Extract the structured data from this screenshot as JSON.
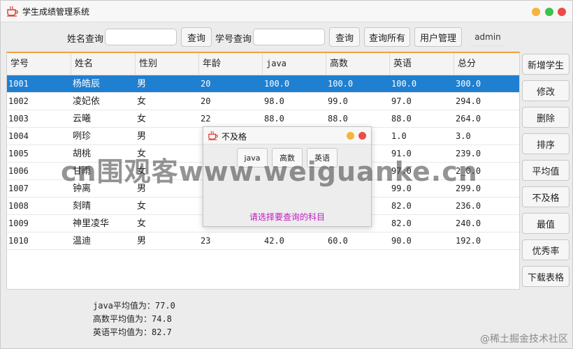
{
  "window": {
    "title": "学生成绩管理系统"
  },
  "search": {
    "name_label": "姓名查询",
    "name_value": "",
    "name_button": "查询",
    "id_label": "学号查询",
    "id_value": "",
    "id_button": "查询",
    "all_button": "查询所有",
    "user_button": "用户管理",
    "current_user": "admin"
  },
  "table": {
    "headers": [
      "学号",
      "姓名",
      "性别",
      "年龄",
      "java",
      "高数",
      "英语",
      "总分"
    ],
    "rows": [
      [
        "1001",
        "杨皓辰",
        "男",
        "20",
        "100.0",
        "100.0",
        "100.0",
        "300.0"
      ],
      [
        "1002",
        "凌妃依",
        "女",
        "20",
        "98.0",
        "99.0",
        "97.0",
        "294.0"
      ],
      [
        "1003",
        "云曦",
        "女",
        "22",
        "88.0",
        "88.0",
        "88.0",
        "264.0"
      ],
      [
        "1004",
        "咧珍",
        "男",
        "",
        "",
        "",
        "1.0",
        "3.0"
      ],
      [
        "1005",
        "胡桃",
        "女",
        "",
        "",
        "",
        "91.0",
        "239.0"
      ],
      [
        "1006",
        "甘雨",
        "女",
        "",
        "",
        "",
        "97.0",
        "2_0.0"
      ],
      [
        "1007",
        "钟离",
        "男",
        "",
        "",
        "",
        "99.0",
        "299.0"
      ],
      [
        "1008",
        "刻晴",
        "女",
        "",
        "",
        "",
        "82.0",
        "236.0"
      ],
      [
        "1009",
        "神里凌华",
        "女",
        "",
        "",
        "",
        "82.0",
        "240.0"
      ],
      [
        "1010",
        "温迪",
        "男",
        "23",
        "42.0",
        "60.0",
        "90.0",
        "192.0"
      ]
    ]
  },
  "side_buttons": [
    "新增学生",
    "修改",
    "删除",
    "排序",
    "平均值",
    "不及格",
    "最值",
    "优秀率",
    "下载表格"
  ],
  "averages": [
    "java平均值为：77.0",
    "高数平均值为：74.8",
    "英语平均值为：82.7"
  ],
  "dialog": {
    "title": "不及格",
    "subjects": [
      "java",
      "高数",
      "英语"
    ],
    "hint": "请选择要查询的科目"
  },
  "watermark": "cn围观客www.weiguanke.cn",
  "corner_watermark": "@稀土掘金技术社区",
  "colors": {
    "selected_row": "#1f7fd1",
    "hint": "#c219c2",
    "table_accent": "#f2a23c"
  }
}
